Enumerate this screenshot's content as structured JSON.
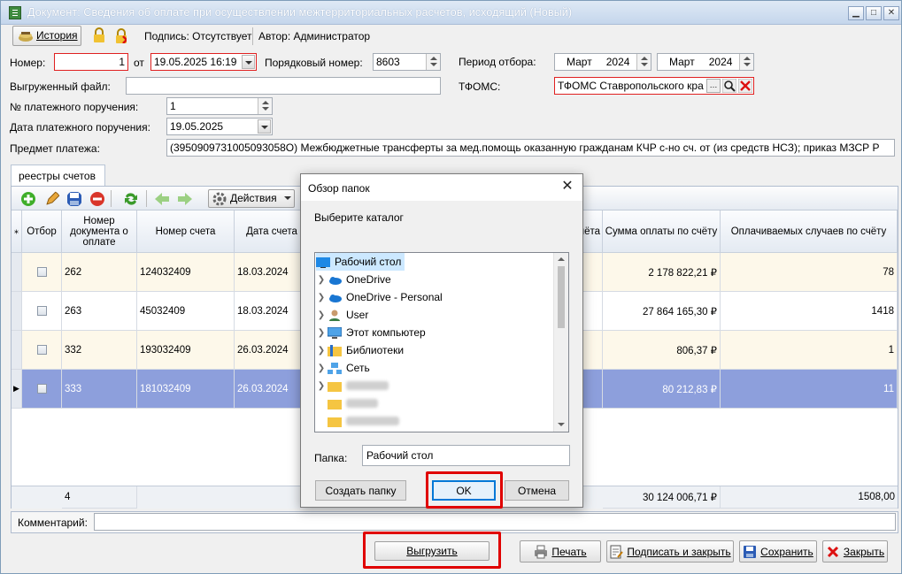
{
  "window": {
    "title": "Документ: Сведения об оплате при осуществлении межтерриториальных расчетов, исходящий (Новый)"
  },
  "toolbar": {
    "history_label": "История",
    "signature_label": "Подпись: Отсутствует",
    "author_label": "Автор: Администратор"
  },
  "form": {
    "number_label": "Номер:",
    "number_value": "1",
    "from_label": "от",
    "date_value": "19.05.2025 16:19",
    "seq_label": "Порядковый номер:",
    "seq_value": "8603",
    "period_label": "Период отбора:",
    "period_from_month": "Март",
    "period_from_year": "2024",
    "period_to_month": "Март",
    "period_to_year": "2024",
    "exported_file_label": "Выгруженный файл:",
    "exported_file_value": "",
    "tfoms_label": "ТФОМС:",
    "tfoms_value": "ТФОМС Ставропольского кра",
    "payment_order_no_label": "№ платежного поручения:",
    "payment_order_no_value": "1",
    "payment_order_date_label": "Дата платежного поручения:",
    "payment_order_date_value": "19.05.2025",
    "payment_subject_label": "Предмет платежа:",
    "payment_subject_value": "(3950909731005093058О) Межбюджетные трансферты за мед.помощь оказанную гражданам КЧР с-но сч. от (из средств НСЗ); приказ МЗСР Р"
  },
  "tabs": [
    {
      "label": "реестры счетов"
    }
  ],
  "grid_toolbar": {
    "actions_label": "Действия"
  },
  "grid": {
    "columns": [
      "Отбор",
      "Номер документа о оплате",
      "Номер счета",
      "Дата счета",
      "чёта",
      "Сумма оплаты по счёту",
      "Оплачиваемых случаев по счёту"
    ],
    "rows": [
      {
        "doc_no": "262",
        "account_no": "124032409",
        "date": "18.03.2024",
        "sum": "2 178 822,21 ₽",
        "cases": "78",
        "selected": false
      },
      {
        "doc_no": "263",
        "account_no": "45032409",
        "date": "18.03.2024",
        "sum": "27 864 165,30 ₽",
        "cases": "1418",
        "selected": false
      },
      {
        "doc_no": "332",
        "account_no": "193032409",
        "date": "26.03.2024",
        "sum": "806,37 ₽",
        "cases": "1",
        "selected": false
      },
      {
        "doc_no": "333",
        "account_no": "181032409",
        "date": "26.03.2024",
        "sum": "80 212,83 ₽",
        "cases": "11",
        "selected": true
      }
    ],
    "footer": {
      "count": "4",
      "sum_total": "30 124 006,71 ₽",
      "cases_total": "1508,00"
    }
  },
  "comment": {
    "label": "Комментарий:",
    "value": ""
  },
  "bottom_buttons": {
    "export": "Выгрузить",
    "print": "Печать",
    "sign_close": "Подписать и закрыть",
    "save": "Сохранить",
    "close": "Закрыть"
  },
  "dialog": {
    "title": "Обзор папок",
    "instruction": "Выберите каталог",
    "tree": [
      {
        "label": "Рабочий стол",
        "icon": "desktop-icon",
        "selected": true,
        "level": 0
      },
      {
        "label": "OneDrive",
        "icon": "cloud-icon",
        "level": 1
      },
      {
        "label": "OneDrive - Personal",
        "icon": "cloud-icon",
        "level": 1
      },
      {
        "label": "User",
        "icon": "user-icon",
        "level": 1
      },
      {
        "label": "Этот компьютер",
        "icon": "computer-icon",
        "level": 1
      },
      {
        "label": "Библиотеки",
        "icon": "library-icon",
        "level": 1
      },
      {
        "label": "Сеть",
        "icon": "network-icon",
        "level": 1
      }
    ],
    "folder_label": "Папка:",
    "folder_value": "Рабочий стол",
    "new_folder_button": "Создать папку",
    "ok_button": "OK",
    "cancel_button": "Отмена"
  },
  "colors": {
    "selection_row": "#8d9fdc",
    "highlight_red": "#e00000",
    "tree_selection": "#cce8ff"
  }
}
